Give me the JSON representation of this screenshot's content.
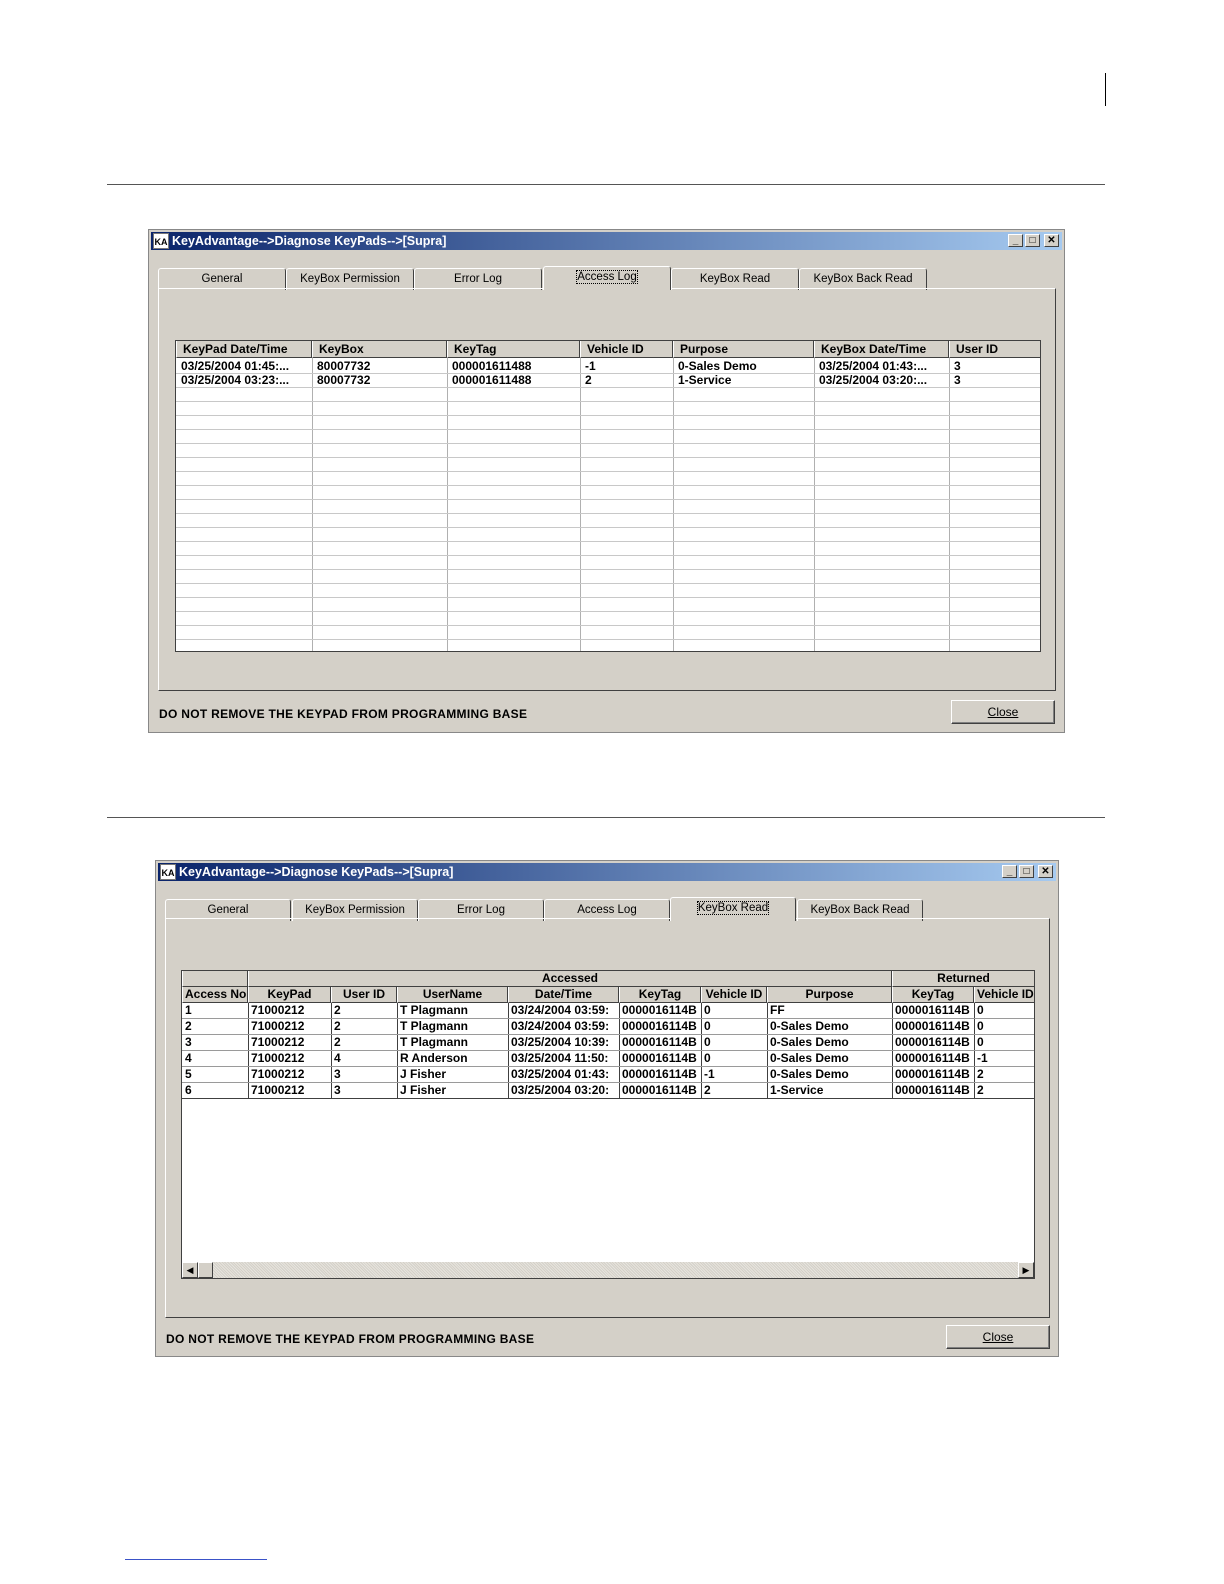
{
  "window_title": "KeyAdvantage-->Diagnose KeyPads-->[Supra]",
  "app_icon_text": "KA",
  "titlebar_buttons": {
    "minimize": "_",
    "maximize": "□",
    "close": "✕"
  },
  "tabs": [
    "General",
    "KeyBox Permission",
    "Error Log",
    "Access Log",
    "KeyBox Read",
    "KeyBox Back Read"
  ],
  "status_message": "DO NOT REMOVE THE KEYPAD FROM PROGRAMMING BASE",
  "close_label": "Close",
  "access_log": {
    "active_tab": "Access Log",
    "columns": [
      "KeyPad Date/Time",
      "KeyBox",
      "KeyTag",
      "Vehicle ID",
      "Purpose",
      "KeyBox Date/Time",
      "User ID"
    ],
    "rows": [
      [
        "03/25/2004 01:45:...",
        "80007732",
        "000001611488",
        "-1",
        "0-Sales Demo",
        "03/25/2004 01:43:...",
        "3"
      ],
      [
        "03/25/2004 03:23:...",
        "80007732",
        "000001611488",
        "2",
        "1-Service",
        "03/25/2004 03:20:...",
        "3"
      ]
    ]
  },
  "keybox_read": {
    "active_tab": "KeyBox Read",
    "group_headers": [
      "Accessed",
      "Returned"
    ],
    "columns": [
      "Access No",
      "KeyPad",
      "User ID",
      "UserName",
      "Date/Time",
      "KeyTag",
      "Vehicle ID",
      "Purpose",
      "KeyTag",
      "Vehicle ID"
    ],
    "rows": [
      [
        "1",
        "71000212",
        "2",
        "T Plagmann",
        "03/24/2004 03:59:",
        "0000016114B",
        "0",
        "FF",
        "0000016114B",
        "0"
      ],
      [
        "2",
        "71000212",
        "2",
        "T Plagmann",
        "03/24/2004 03:59:",
        "0000016114B",
        "0",
        "0-Sales Demo",
        "0000016114B",
        "0"
      ],
      [
        "3",
        "71000212",
        "2",
        "T Plagmann",
        "03/25/2004 10:39:",
        "0000016114B",
        "0",
        "0-Sales Demo",
        "0000016114B",
        "0"
      ],
      [
        "4",
        "71000212",
        "4",
        "R Anderson",
        "03/25/2004 11:50:",
        "0000016114B",
        "0",
        "0-Sales Demo",
        "0000016114B",
        "-1"
      ],
      [
        "5",
        "71000212",
        "3",
        "J Fisher",
        "03/25/2004 01:43:",
        "0000016114B",
        "-1",
        "0-Sales Demo",
        "0000016114B",
        "2"
      ],
      [
        "6",
        "71000212",
        "3",
        "J Fisher",
        "03/25/2004 03:20:",
        "0000016114B",
        "2",
        "1-Service",
        "0000016114B",
        "2"
      ]
    ],
    "scroll_left": "◀",
    "scroll_right": "▶"
  }
}
